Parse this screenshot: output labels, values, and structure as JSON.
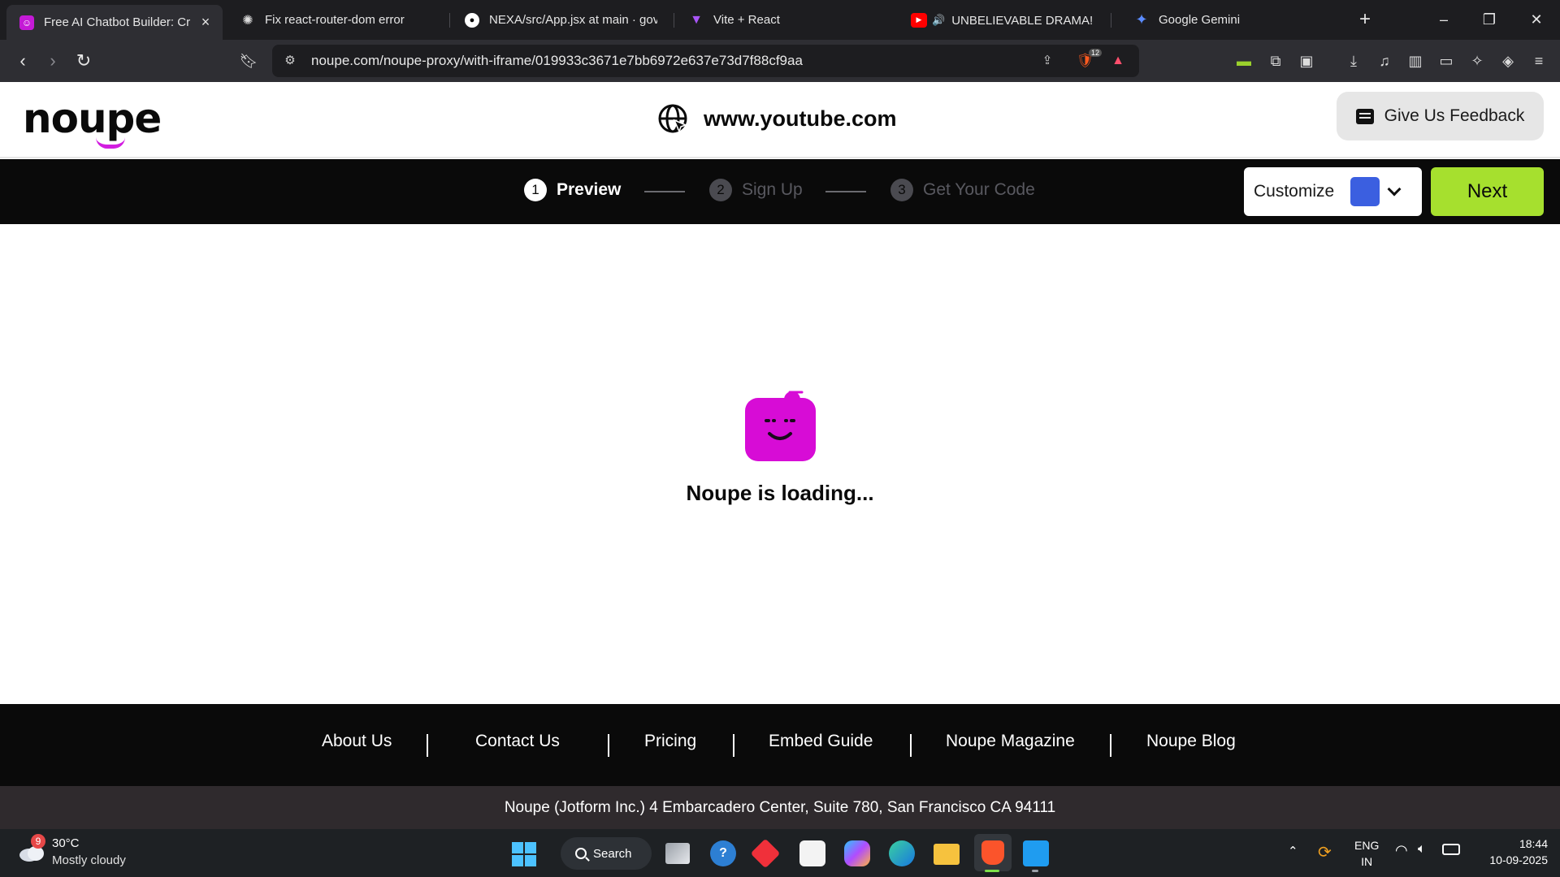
{
  "browser": {
    "tabs": [
      {
        "label": "Free AI Chatbot Builder: Cre",
        "favicon": "noupe-favicon",
        "active": true,
        "close": "×"
      },
      {
        "label": "Fix react-router-dom error",
        "favicon": "chatgpt-favicon",
        "active": false
      },
      {
        "label": "NEXA/src/App.jsx at main · govir",
        "favicon": "github-favicon",
        "active": false
      },
      {
        "label": "Vite + React",
        "favicon": "vite-favicon",
        "active": false
      },
      {
        "label": "UNBELIEVABLE DRAMA! 🙊",
        "favicon": "youtube-favicon",
        "active": false
      },
      {
        "label": "Google Gemini",
        "favicon": "gemini-favicon",
        "active": false
      }
    ],
    "new_tab": "+",
    "window_controls": {
      "minimize": "–",
      "restore": "❐",
      "close": "✕"
    },
    "url": "noupe.com/noupe-proxy/with-iframe/019933c3671e7bb6972e637e73d7f88cf9aa",
    "brave_shield_count": "12"
  },
  "site": {
    "logo_text": "noupe",
    "domain": "www.youtube.com",
    "feedback_label": "Give Us Feedback",
    "steps": [
      {
        "num": "1",
        "label": "Preview",
        "active": true
      },
      {
        "num": "2",
        "label": "Sign Up",
        "active": false
      },
      {
        "num": "3",
        "label": "Get Your Code",
        "active": false
      }
    ],
    "customize_label": "Customize",
    "customize_color": "#3b5fe0",
    "next_label": "Next",
    "loading_text": "Noupe is loading..."
  },
  "footer": {
    "links": [
      "About Us",
      "Contact Us",
      "Pricing",
      "Embed Guide",
      "Noupe Magazine",
      "Noupe Blog"
    ],
    "address": "Noupe (Jotform Inc.) 4 Embarcadero Center, Suite 780, San Francisco CA 94111"
  },
  "taskbar": {
    "weather_badge": "9",
    "temperature": "30°C",
    "weather": "Mostly cloudy",
    "search_label": "Search",
    "language": "ENG",
    "region": "IN",
    "time": "18:44",
    "date": "10-09-2025"
  },
  "colors": {
    "brand_magenta": "#d21de0",
    "next_green": "#a6e02e",
    "footer_dark": "#0a0a0a"
  }
}
